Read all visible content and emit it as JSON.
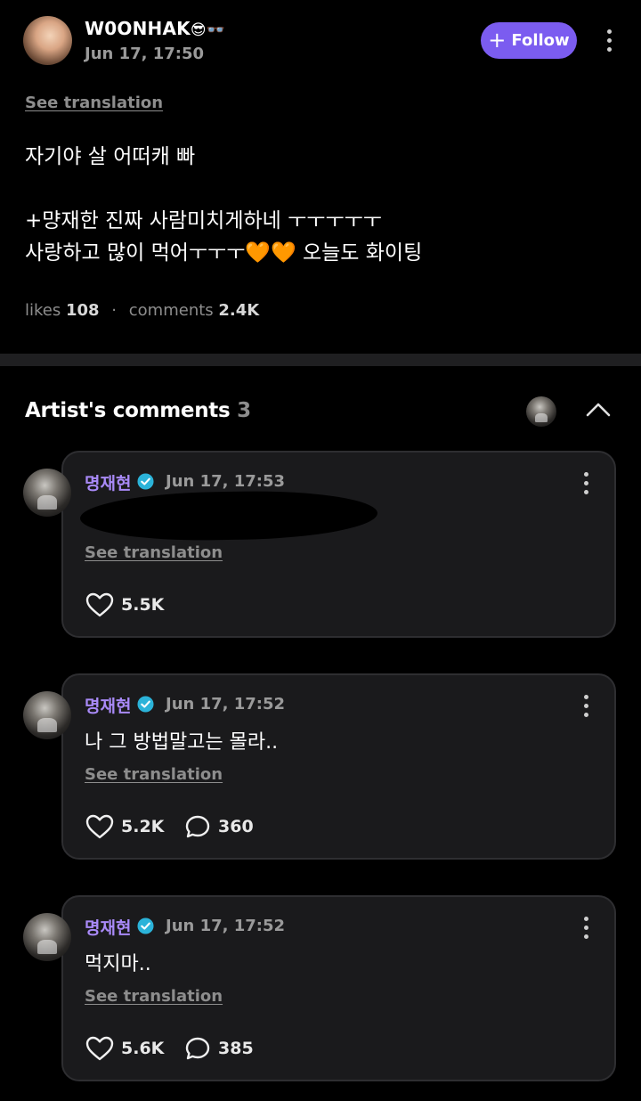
{
  "post": {
    "username": "W0ONHAK",
    "username_emoji": "😎👓",
    "time": "Jun 17, 17:50",
    "follow_label": "Follow",
    "see_translation": "See translation",
    "body": "자기야 살 어떠캐 빠\n\n+먕재한 진짜 사람미치게하네 ㅜㅜㅜㅜㅜ\n사랑하고 많이 먹어ㅜㅜㅜ🧡🧡 오늘도 화이팅",
    "likes_label": "likes",
    "likes_count": "108",
    "comments_label": "comments",
    "comments_count": "2.4K"
  },
  "artist_comments": {
    "title": "Artist's comments",
    "count": "3",
    "items": [
      {
        "name": "명재현",
        "time": "Jun 17, 17:53",
        "text": "",
        "redacted": true,
        "see_translation": "See translation",
        "likes": "5.5K",
        "replies": null
      },
      {
        "name": "명재현",
        "time": "Jun 17, 17:52",
        "text": "나 그 방법말고는 몰라..",
        "see_translation": "See translation",
        "likes": "5.2K",
        "replies": "360"
      },
      {
        "name": "명재현",
        "time": "Jun 17, 17:52",
        "text": "먹지마..",
        "see_translation": "See translation",
        "likes": "5.6K",
        "replies": "385"
      }
    ]
  },
  "icons": [
    "more-vertical-icon",
    "plus-icon",
    "chevron-up-icon",
    "heart-icon",
    "comment-bubble-icon",
    "verified-badge-icon"
  ],
  "colors": {
    "accent": "#7b5cf0",
    "artist_name": "#a98af8",
    "verified": "#2bb3d9",
    "card_bg": "#1a1a1c"
  }
}
